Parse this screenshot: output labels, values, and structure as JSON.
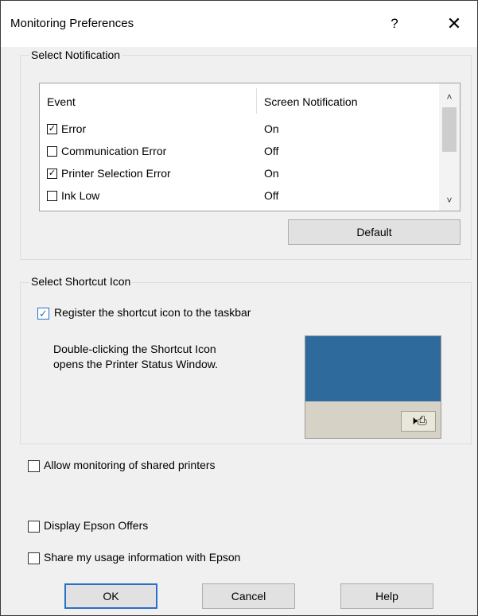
{
  "window": {
    "title": "Monitoring Preferences",
    "help_glyph": "?",
    "close_glyph": "✕"
  },
  "notification": {
    "group_title": "Select Notification",
    "columns": {
      "event": "Event",
      "screen": "Screen Notification"
    },
    "rows": [
      {
        "event": "Error",
        "screen": "On",
        "checked": true
      },
      {
        "event": "Communication Error",
        "screen": "Off",
        "checked": false
      },
      {
        "event": "Printer Selection Error",
        "screen": "On",
        "checked": true
      },
      {
        "event": "Ink Low",
        "screen": "Off",
        "checked": false
      }
    ],
    "default_button": "Default"
  },
  "shortcut": {
    "group_title": "Select Shortcut Icon",
    "register_label": "Register the shortcut icon to the taskbar",
    "register_checked": true,
    "description_line1": "Double-clicking the Shortcut Icon",
    "description_line2": "opens the Printer Status Window.",
    "preview_colors": {
      "desktop": "#2e6b9c",
      "taskbar": "#d6d3c6"
    },
    "tray_icon": "printer-speaker-tray-icon"
  },
  "options": {
    "shared_printers": "Allow monitoring of shared printers",
    "epson_offers": "Display Epson Offers",
    "usage_info": "Share my usage information with Epson"
  },
  "buttons": {
    "ok": "OK",
    "cancel": "Cancel",
    "help": "Help"
  }
}
